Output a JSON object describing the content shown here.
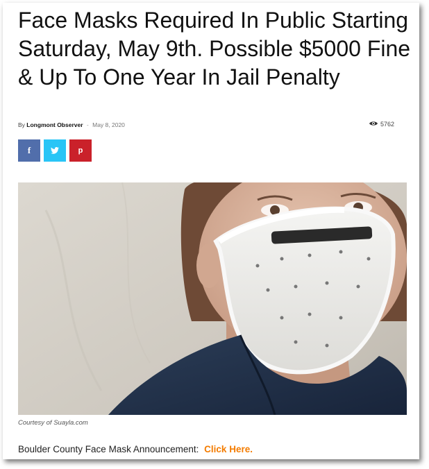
{
  "article": {
    "title": "Face Masks Required In Public Starting Saturday, May 9th. Possible $5000 Fine & Up To One Year In Jail Penalty",
    "byline_prefix": "By",
    "author": "Longmont Observer",
    "separator": "-",
    "date": "May 8, 2020",
    "views": "5762",
    "view_icon": "eye-icon"
  },
  "share": {
    "facebook_glyph": "f",
    "twitter_icon": "twitter-bird-icon",
    "pinterest_glyph": "p",
    "colors": {
      "facebook": "#516eab",
      "twitter": "#29c5f6",
      "pinterest": "#ca212a"
    }
  },
  "image": {
    "caption": "Courtesy of Suayla.com"
  },
  "announcement": {
    "text": "Boulder County Face Mask Announcement:",
    "link_text": "Click Here.",
    "link_color": "#f47c00"
  }
}
